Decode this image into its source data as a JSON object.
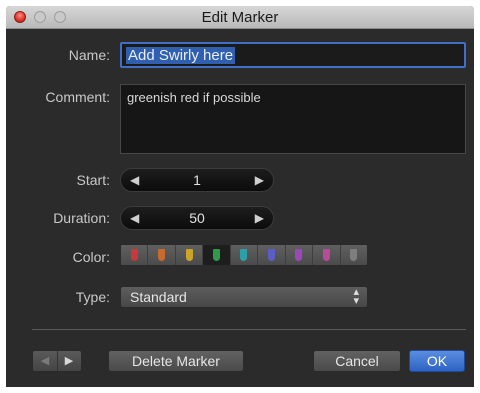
{
  "window": {
    "title": "Edit Marker"
  },
  "form": {
    "name_label": "Name:",
    "name_value": "Add Swirly here",
    "comment_label": "Comment:",
    "comment_value": "greenish red if possible",
    "start_label": "Start:",
    "start_value": "1",
    "duration_label": "Duration:",
    "duration_value": "50",
    "color_label": "Color:",
    "type_label": "Type:",
    "type_value": "Standard"
  },
  "colors": {
    "selected_index": 3,
    "swatches": [
      "#c9383a",
      "#c86a2e",
      "#c9a52a",
      "#2f9a4a",
      "#2aa0a8",
      "#5a5fc8",
      "#9a4ab8",
      "#b84a9a",
      "#7e7e7e"
    ]
  },
  "icons": {
    "left_arrow": "◀",
    "right_arrow": "▶",
    "select_caret": "▴▾"
  },
  "footer": {
    "delete_label": "Delete Marker",
    "cancel_label": "Cancel",
    "ok_label": "OK"
  }
}
